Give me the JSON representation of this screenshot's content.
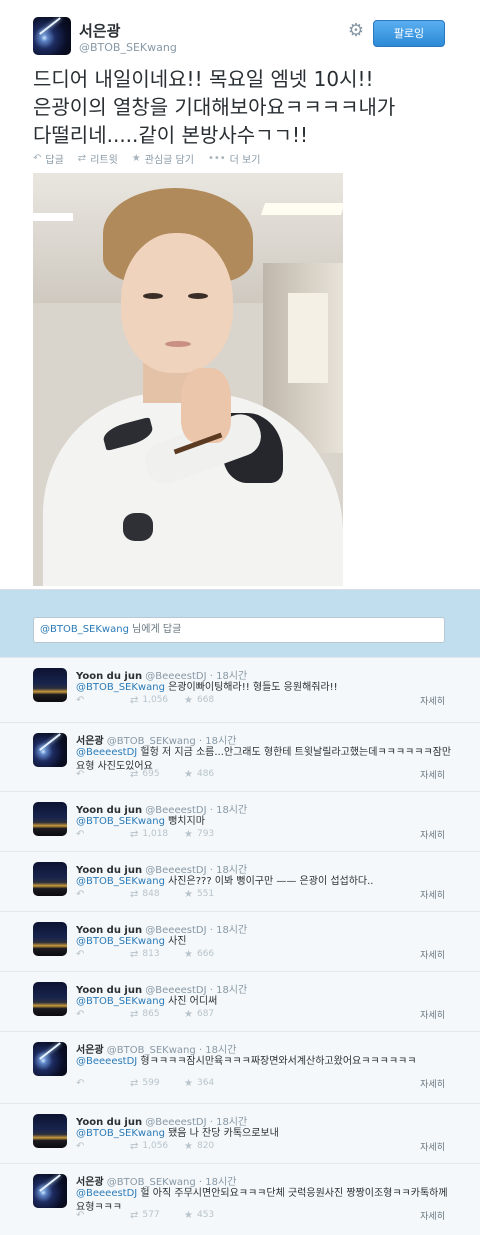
{
  "tweet": {
    "name": "서은광",
    "handle": "@BTOB_SEKwang",
    "follow_label": "팔로잉",
    "gear_icon": "gear-icon",
    "lines": [
      "드디어 내일이네요!! 목요일 엠넷 10시!!",
      "은광이의 열창을 기대해보아요ㅋㅋㅋㅋ내가",
      "다떨리네.....같이 본방사수ㄱㄱ!!"
    ],
    "actions": {
      "reply": "답글",
      "retweet": "리트윗",
      "favorite": "관심글 담기",
      "more": "더 보기"
    }
  },
  "reply_box": {
    "mention": "@BTOB_SEKwang",
    "suffix": " 님에게 답글"
  },
  "detail_label": "자세히",
  "replies": [
    {
      "name": "Yoon du jun",
      "handle": "@BeeeestDJ",
      "time": "18시간",
      "mention": "@BTOB_SEKwang",
      "text": " 은광이빠이팅해라!! 형들도 응원해줘라!!",
      "rt": "1,056",
      "fav": "668"
    },
    {
      "name": "서은광",
      "handle": "@BTOB_SEKwang",
      "time": "18시간",
      "mention": "@BeeeestDJ",
      "text": " 헐헝 저 지금 소름...안그래도 형한테 트윗날릴라고했는데ㅋㅋㅋㅋㅋㅋ잠만요형 사진도있어요",
      "rt": "695",
      "fav": "486"
    },
    {
      "name": "Yoon du jun",
      "handle": "@BeeeestDJ",
      "time": "18시간",
      "mention": "@BTOB_SEKwang",
      "text": " 뻥치지마",
      "rt": "1,018",
      "fav": "793"
    },
    {
      "name": "Yoon du jun",
      "handle": "@BeeeestDJ",
      "time": "18시간",
      "mention": "@BTOB_SEKwang",
      "text": " 사진은??? 이봐 뻥이구만 —— 은광이 섭섭하다..",
      "rt": "848",
      "fav": "551"
    },
    {
      "name": "Yoon du jun",
      "handle": "@BeeeestDJ",
      "time": "18시간",
      "mention": "@BTOB_SEKwang",
      "text": " 사진",
      "rt": "813",
      "fav": "666"
    },
    {
      "name": "Yoon du jun",
      "handle": "@BeeeestDJ",
      "time": "18시간",
      "mention": "@BTOB_SEKwang",
      "text": " 사진 어디써",
      "rt": "865",
      "fav": "687"
    },
    {
      "name": "서은광",
      "handle": "@BTOB_SEKwang",
      "time": "18시간",
      "mention": "@BeeeestDJ",
      "text": " 형ㅋㅋㅋㅋ잠시만육ㅋㅋㅋ짜장면와서계산하고왔어요ㅋㅋㅋㅋㅋㅋ",
      "rt": "599",
      "fav": "364"
    },
    {
      "name": "Yoon du jun",
      "handle": "@BeeeestDJ",
      "time": "18시간",
      "mention": "@BTOB_SEKwang",
      "text": " 됐음 나 잔당 카톡으로보내",
      "rt": "1,056",
      "fav": "820"
    },
    {
      "name": "서은광",
      "handle": "@BTOB_SEKwang",
      "time": "18시간",
      "mention": "@BeeeestDJ",
      "text": " 헐 아직 주무시면안되요ㅋㅋㅋ단체 긋럭응원사진 짱짱이조형ㅋㅋ카톡하께요형ㅋㅋㅋ",
      "rt": "577",
      "fav": "453"
    }
  ]
}
